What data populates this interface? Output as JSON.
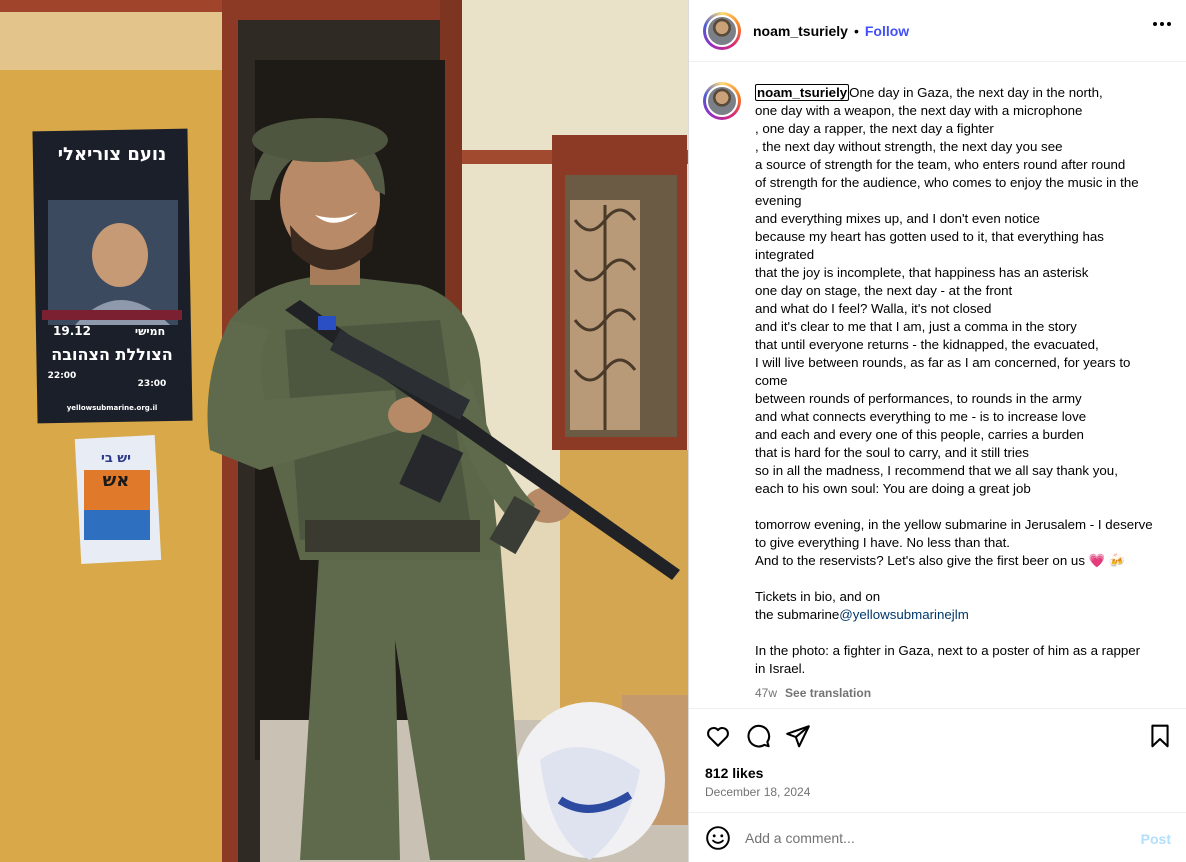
{
  "post": {
    "username": "noam_tsuriely",
    "follow_label": "Follow",
    "separator": "•"
  },
  "photo": {
    "poster_big": {
      "title_hebrew": "נועם צוריאלי",
      "date": "19.12",
      "day": "חמישי",
      "venue_hebrew": "הצוללת הצהובה",
      "time_doors": "22:00",
      "time_show": "23:00",
      "url": "yellowsubmarine.org.il"
    },
    "poster_small": {
      "line1": "יש בי",
      "line2": "אש"
    }
  },
  "caption": {
    "username": "noam_tsuriely",
    "lines": [
      "One day in Gaza, the next day in the north,",
      "one day with a weapon, the next day with a microphone",
      ", one day a rapper, the next day a fighter",
      ", the next day without strength, the next day you see",
      "a source of strength for the team, who enters round after round",
      "of strength for the audience, who comes to enjoy the music in the",
      "evening",
      "and everything mixes up, and I don't even notice",
      "because my heart has gotten used to it, that everything has",
      "integrated",
      "that the joy is incomplete, that happiness has an asterisk",
      "one day on stage, the next day - at the front",
      "and what do I feel? Walla, it's not closed",
      "and it's clear to me that I am, just a comma in the story",
      "that until everyone returns - the kidnapped, the evacuated,",
      "I will live between rounds, as far as I am concerned, for years to",
      "come",
      "between rounds of performances, to rounds in the army",
      "and what connects everything to me - is to increase love",
      "and each and every one of this people, carries a burden",
      "that is hard for the soul to carry, and it still tries",
      "so in all the madness, I recommend that we all say thank you,",
      "each to his own soul: You are doing a great job",
      "",
      "tomorrow evening, in the yellow submarine in Jerusalem - I deserve",
      "to give everything I have. No less than that.",
      "And to the reservists? Let's also give the first beer on us 💗 🍻",
      "",
      "Tickets in bio, and on"
    ],
    "mention_prefix": "the submarine",
    "mention": "@yellowsubmarinejlm",
    "lines_after": [
      "",
      "In the photo: a fighter in Gaza, next to a poster of him as a rapper",
      "in Israel."
    ],
    "age": "47w",
    "see_translation": "See translation"
  },
  "actions": {
    "likes": "812 likes",
    "date": "December 18, 2024"
  },
  "comment": {
    "placeholder": "Add a comment...",
    "post_label": "Post"
  },
  "colors": {
    "follow": "#4150f7",
    "post_disabled": "#b2dffc",
    "muted": "#737373",
    "mention": "#00376b"
  }
}
